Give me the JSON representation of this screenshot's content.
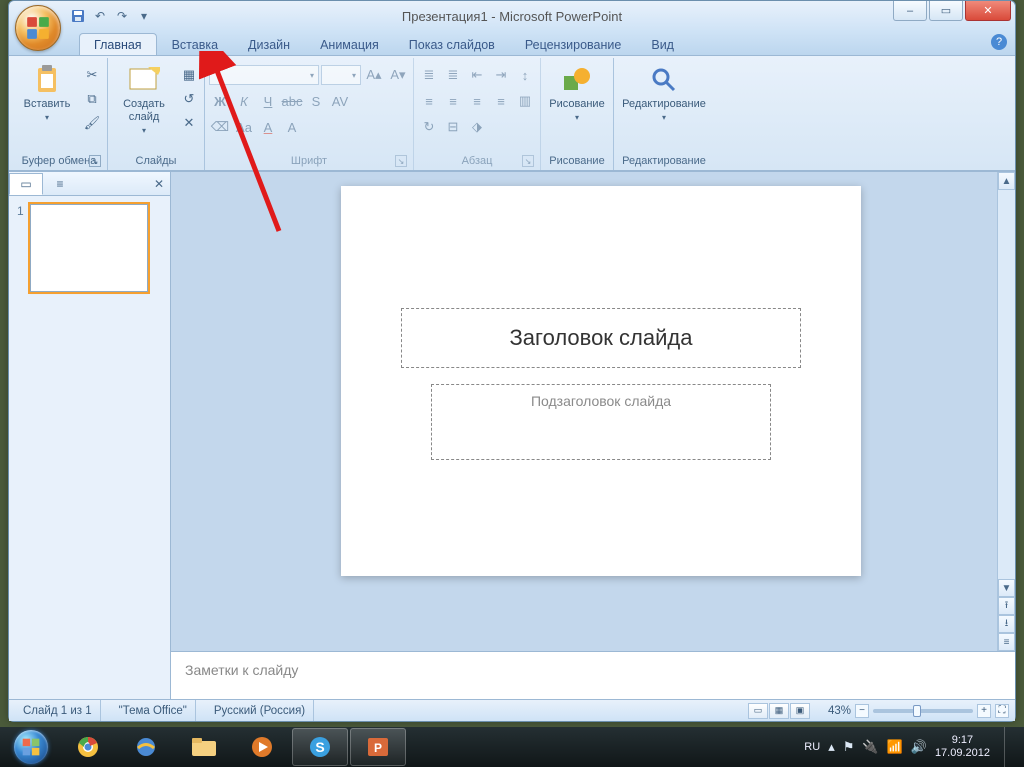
{
  "title": "Презентация1 - Microsoft PowerPoint",
  "qat": {
    "save_tip": "save",
    "undo_tip": "undo",
    "redo_tip": "redo"
  },
  "win": {
    "min": "–",
    "max": "▭",
    "close": "✕"
  },
  "tabs": {
    "home": "Главная",
    "insert": "Вставка",
    "design": "Дизайн",
    "animation": "Анимация",
    "slideshow": "Показ слайдов",
    "review": "Рецензирование",
    "view": "Вид"
  },
  "ribbon": {
    "clipboard": {
      "label": "Буфер обмена",
      "paste": "Вставить"
    },
    "slides": {
      "label": "Слайды",
      "new_slide": "Создать\nслайд"
    },
    "font": {
      "label": "Шрифт",
      "font_name": "",
      "font_size": ""
    },
    "paragraph": {
      "label": "Абзац"
    },
    "drawing": {
      "label": "Рисование",
      "btn": "Рисование"
    },
    "editing": {
      "label": "Редактирование",
      "btn": "Редактирование"
    }
  },
  "panel": {
    "slides_tab": "▭",
    "outline_tab": "≡",
    "thumb_number": "1"
  },
  "slide": {
    "title_placeholder": "Заголовок слайда",
    "subtitle_placeholder": "Подзаголовок слайда"
  },
  "notes": {
    "placeholder": "Заметки к слайду"
  },
  "status": {
    "slide_count": "Слайд 1 из 1",
    "theme": "\"Тема Office\"",
    "language": "Русский (Россия)",
    "zoom": "43%"
  },
  "tray": {
    "lang": "RU",
    "time": "9:17",
    "date": "17.09.2012"
  }
}
